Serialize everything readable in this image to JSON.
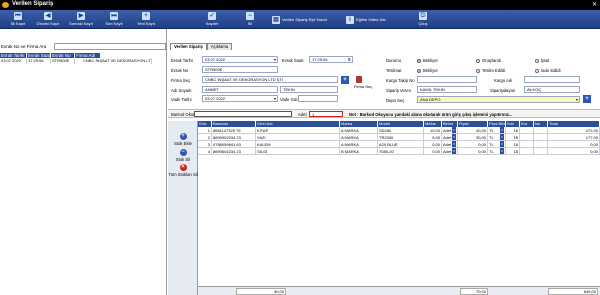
{
  "window": {
    "title": "Verilen Sipariş",
    "close": "✕"
  },
  "toolbar": {
    "ilk": "İlk Kayıt",
    "onceki": "Önceki Kayıt",
    "sonraki": "Sonraki Kayıt",
    "son": "Son Kayıt",
    "yeni": "Yeni Kayıt",
    "kaydet": "Kaydet",
    "sil": "Sil",
    "yazdir": "Verilen Sipariş Rpt Yazdır",
    "egitim": "Eğitim Video İzle",
    "cikis": "Çıkış"
  },
  "search": {
    "label": "Evrak No ve Firma Ara",
    "value": ""
  },
  "left_list": {
    "columns": [
      "Evrak Tarihi",
      "Evrak Saati",
      "Evrak No",
      "Firma Adı"
    ],
    "rows": [
      [
        "03.07.2022",
        "17:25:54",
        "STR500E",
        "CNBC İNŞAAT VE DEKORASYON LTD"
      ]
    ]
  },
  "tabs": [
    "Verilen Sipariş",
    "Açıklama"
  ],
  "form": {
    "evrak_tarihi_label": "Evrak Tarihi",
    "evrak_tarihi": "03.07.2022",
    "evrak_saati_label": "Evrak Saati",
    "evrak_saati": "17:25:54",
    "evrak_no_label": "Evrak No",
    "evrak_no": "STR500E",
    "firma_sec_label": "Firma Seç",
    "firma": "CNBC İNŞAAT VE DEKORASYON LTD ŞTİ",
    "firma_sec_button": "Firma Seç",
    "adi_soyadi_label": "Adı Soyadı",
    "adi": "AHMET",
    "soyadi": "TEKİN",
    "siparis_tarihi_label": "Sipariş Tarihi",
    "siparis_tarihi": "03.07.2022",
    "vade_tarihi_label": "Vade Tarihi",
    "vade_tarihi": "03.07.2022",
    "vade_gunu_label": "Vade Günü",
    "vade_gunu": "",
    "durumu_label": "Durumu",
    "durumu_options": [
      "Bekliyor",
      "Onaylandı",
      "İptal"
    ],
    "teslimat_label": "Teslimat",
    "teslimat_options": [
      "Bekliyor",
      "Teslim Edildi",
      "İade Edildi"
    ],
    "kargo_takip_label": "Kargo Takip No",
    "kargo_takip": "",
    "kargo_adi_label": "Kargo Adı",
    "kargo_adi": "",
    "siparis_veren_label": "Sipariş Veren",
    "siparis_veren": "KAMİL TEKİN",
    "sipariskayan_label": "Siparişalayan",
    "sipariskayan": "Ali KOÇ",
    "depo_sec_label": "Depo Seç",
    "depo": "ANA DEPO"
  },
  "barcode": {
    "label": "Barkod Okut",
    "value": "",
    "adet_label": "Adet",
    "adet": "1",
    "note": "Not : Barkod Okuyucu yandaki alana okutarak ürün giriş çıkış işlemini yapıtırınız..."
  },
  "side_buttons": {
    "ekle": "Stok Ekle",
    "sil": "Stok Sil",
    "tumu_sil": "Tüm Stokları Sil"
  },
  "grid": {
    "columns": [
      "Sıra",
      "Barkodu",
      "Ürün Adı",
      "Marka",
      "Model",
      "Miktar",
      "Birimi",
      "Fiyatı",
      "Para Birimi",
      "Kdv",
      "Kur",
      "İsk",
      "Tutar"
    ],
    "rows": [
      [
        "1",
        "8681147325 79",
        "KİTAP",
        "A MARKA",
        "SD280",
        "10,00",
        "Adet",
        "40,00",
        "TL",
        "18",
        "",
        "",
        "472,00"
      ],
      [
        "2",
        "8690902034 23",
        "YAZI",
        "A MARKA",
        "TR2300",
        "5,00",
        "Adet",
        "30,00",
        "TL",
        "18",
        "",
        "",
        "177,00"
      ],
      [
        "3",
        "9786059841 63",
        "KALEM",
        "A MARKA",
        "A20 BLUE",
        "0,00",
        "Adet",
        "0,00",
        "TL",
        "18",
        "",
        "",
        "0,00"
      ],
      [
        "4",
        "8690604234 23",
        "SİLGİ",
        "B MARKA",
        "7085-20",
        "0,00",
        "Adet",
        "0,00",
        "TL",
        "18",
        "",
        "",
        "0,00"
      ]
    ]
  },
  "footer": {
    "miktar_total": "30,00",
    "fiyat_total": "70,00",
    "tutar_total": "649,00"
  },
  "colors": {
    "toolbar": "#2a4b96",
    "header": "#2d4f9a",
    "accent_red": "#d02020"
  }
}
